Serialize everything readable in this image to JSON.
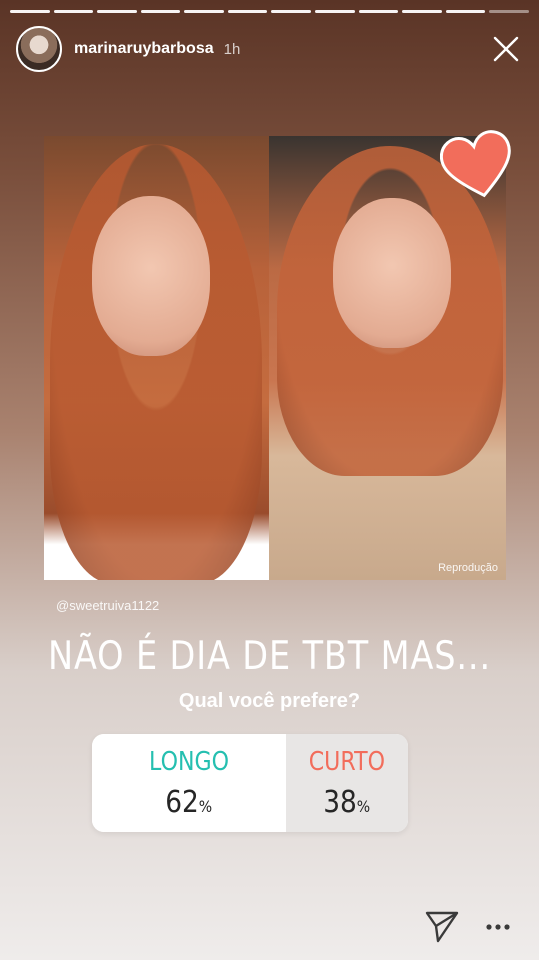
{
  "story": {
    "segments_total": 12,
    "segments_done": 11,
    "username": "marinaruybarbosa",
    "time": "1h"
  },
  "photo": {
    "watermark": "Reprodução"
  },
  "stickers": {
    "heart_icon": "heart-icon",
    "heart_color": "#f26d5b"
  },
  "mention": "@sweetruiva1122",
  "headline": "NÃO É DIA DE TBT MAS...",
  "question": "Qual você prefere?",
  "poll": {
    "option_a": {
      "label": "LONGO",
      "percent": "62",
      "color": "#25bfb0"
    },
    "option_b": {
      "label": "CURTO",
      "percent": "38",
      "color": "#f26d5b"
    },
    "percent_sign": "%"
  },
  "icons": {
    "close": "close-icon",
    "send": "send-icon",
    "more": "more-icon"
  }
}
